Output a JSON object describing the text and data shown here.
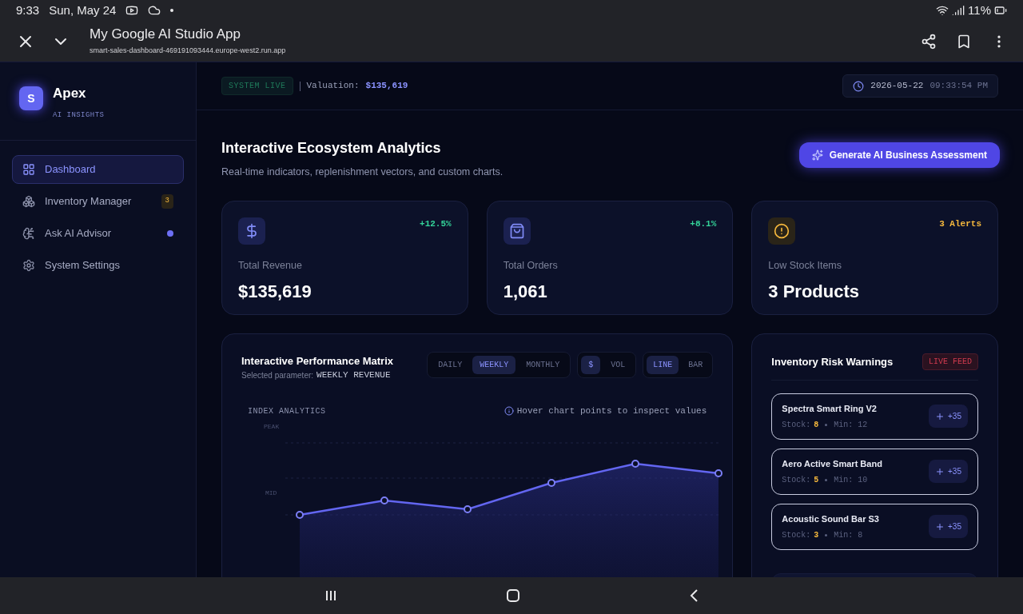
{
  "status_bar": {
    "time": "9:33",
    "date": "Sun, May 24",
    "battery": "11%"
  },
  "browser": {
    "title": "My Google AI Studio App",
    "url": "smart-sales-dashboard-469191093444.europe-west2.run.app"
  },
  "sidebar": {
    "logo_letter": "S",
    "brand": "Apex",
    "tagline": "AI INSIGHTS",
    "items": [
      {
        "label": "Dashboard",
        "selected": true,
        "kind": "dashboard"
      },
      {
        "label": "Inventory Manager",
        "selected": false,
        "kind": "inventory",
        "badge": "3"
      },
      {
        "label": "Ask AI Advisor",
        "selected": false,
        "kind": "advisor",
        "dot": true
      },
      {
        "label": "System Settings",
        "selected": false,
        "kind": "settings"
      }
    ]
  },
  "header": {
    "status": "SYSTEM LIVE",
    "valuation_label": "Valuation:",
    "valuation": "$135,619",
    "date": "2026-05-22",
    "time": "09:33:54 PM"
  },
  "page": {
    "title": "Interactive Ecosystem Analytics",
    "subtitle": "Real-time indicators, replenishment vectors, and custom charts.",
    "action": "Generate AI Business Assessment"
  },
  "stats": [
    {
      "kind": "revenue",
      "label": "Total Revenue",
      "value": "$135,619",
      "change": "+12.5%",
      "color": "#34d399"
    },
    {
      "kind": "orders",
      "label": "Total Orders",
      "value": "1,061",
      "change": "+8.1%",
      "color": "#34d399"
    },
    {
      "kind": "alerts",
      "label": "Low Stock Items",
      "value": "3 Products",
      "change": "3 Alerts",
      "color": "#f5b83d"
    }
  ],
  "chart_panel": {
    "title": "Interactive Performance Matrix",
    "param_label": "Selected parameter:",
    "param": "WEEKLY REVENUE",
    "periods": [
      {
        "label": "DAILY",
        "selected": false
      },
      {
        "label": "WEEKLY",
        "selected": true
      },
      {
        "label": "MONTHLY",
        "selected": false
      }
    ],
    "metrics": [
      {
        "label": "$",
        "selected": true
      },
      {
        "label": "VOL",
        "selected": false
      }
    ],
    "modes": [
      {
        "label": "LINE",
        "selected": true
      },
      {
        "label": "BAR",
        "selected": false
      }
    ],
    "section_label": "INDEX ANALYTICS",
    "hint": "Hover chart points to inspect values",
    "y_labels": [
      "PEAK",
      "MID"
    ]
  },
  "inventory": {
    "title": "Inventory Risk Warnings",
    "badge": "LIVE FEED",
    "items": [
      {
        "name": "Spectra Smart Ring V2",
        "stock_label": "Stock:",
        "stock": "8",
        "min": "Min: 12",
        "action": "+35"
      },
      {
        "name": "Aero Active Smart Band",
        "stock_label": "Stock:",
        "stock": "5",
        "min": "Min: 10",
        "action": "+35"
      },
      {
        "name": "Acoustic Sound Bar S3",
        "stock_label": "Stock:",
        "stock": "3",
        "min": "Min: 8",
        "action": "+35"
      }
    ]
  }
}
